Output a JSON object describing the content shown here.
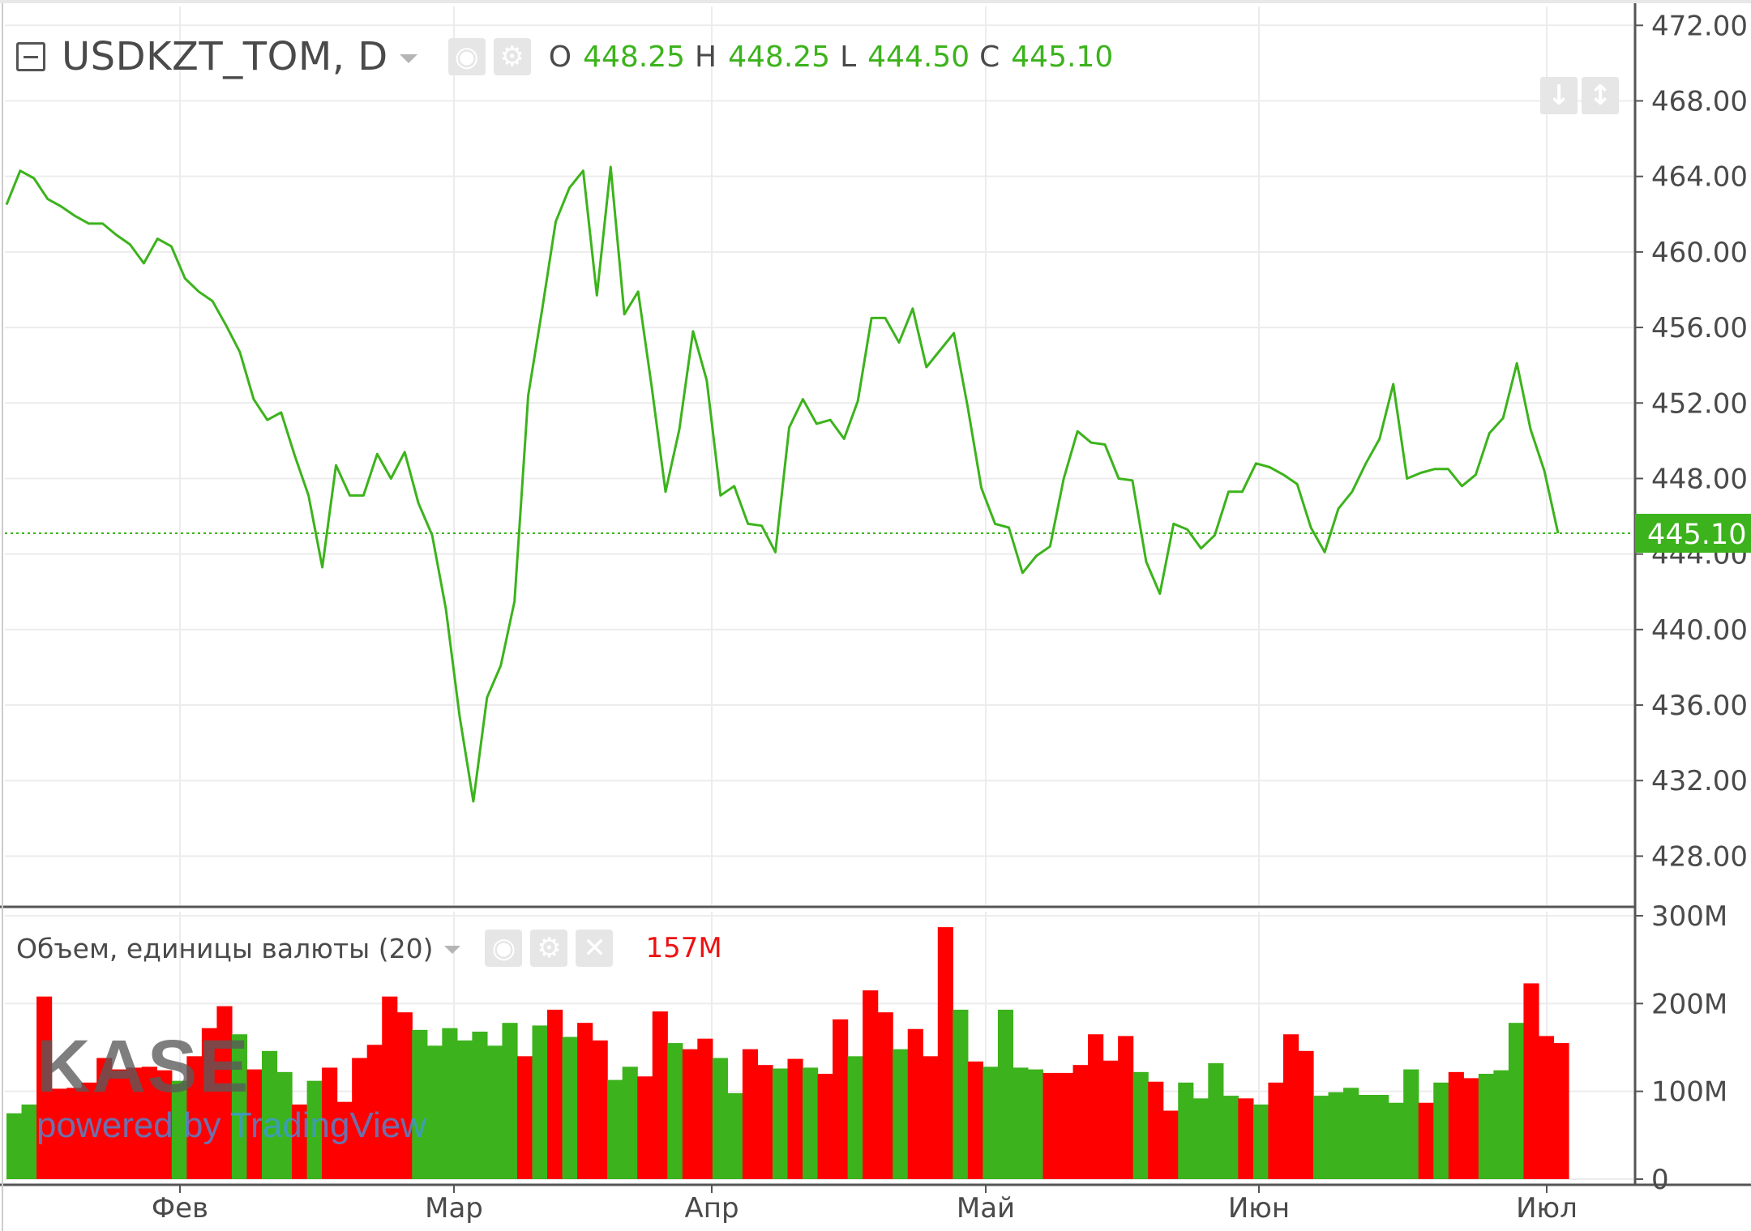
{
  "header": {
    "symbol": "USDKZT_TOM, D",
    "o_label": "O",
    "o_value": "448.25",
    "h_label": "H",
    "h_value": "448.25",
    "l_label": "L",
    "l_value": "444.50",
    "c_label": "C",
    "c_value": "445.10",
    "icons": [
      "eye-icon",
      "gear-icon"
    ]
  },
  "volume_header": {
    "title": "Объем, единицы валюты (20)",
    "value": "157M",
    "icons": [
      "eye-icon",
      "gear-icon",
      "close-icon"
    ]
  },
  "scroll_buttons": [
    "scroll-down-icon",
    "scroll-updown-icon"
  ],
  "logo": {
    "brand": "KASE",
    "sub": "powered by TradingView"
  },
  "colors": {
    "line": "#3cb31c",
    "up": "#3cb31c",
    "down": "#ff0000",
    "grid": "#ececec",
    "text": "#4a4a4a",
    "last_price_bg": "#3cb31c"
  },
  "chart_data": [
    {
      "type": "line",
      "title": "USDKZT_TOM, D",
      "series": [
        {
          "values": [
            462.5,
            464.3,
            463.9,
            462.8,
            462.4,
            461.9,
            461.5,
            461.5,
            460.9,
            460.4,
            459.4,
            460.7,
            460.3,
            458.6,
            457.9,
            457.4,
            456.1,
            454.7,
            452.2,
            451.1,
            451.5,
            449.2,
            447.1,
            443.3,
            448.7,
            447.1,
            447.1,
            449.3,
            448.0,
            449.4,
            446.7,
            445.0,
            441.1,
            435.4,
            430.9,
            436.4,
            438.1,
            441.5,
            452.4,
            456.9,
            461.6,
            463.4,
            464.3,
            457.7,
            464.5,
            456.7,
            457.9,
            452.8,
            447.3,
            450.6,
            455.8,
            453.2,
            447.1,
            447.6,
            445.6,
            445.5,
            444.1,
            450.7,
            452.2,
            450.9,
            451.1,
            450.1,
            452.1,
            456.5,
            456.5,
            455.2,
            457.0,
            453.9,
            454.8,
            455.7,
            451.8,
            447.5,
            445.6,
            445.4,
            443.0,
            443.9,
            444.4,
            448.0,
            450.5,
            449.9,
            449.8,
            448.0,
            447.9,
            443.6,
            441.9,
            445.6,
            445.3,
            444.3,
            445.0,
            447.3,
            447.3,
            448.8,
            448.6,
            448.2,
            447.7,
            445.4,
            444.1,
            446.4,
            447.3,
            448.8,
            450.1,
            453.0,
            448.0,
            448.3,
            448.5,
            448.5,
            447.6,
            448.2,
            450.4,
            451.2,
            454.1,
            450.6,
            448.4,
            445.1
          ]
        }
      ],
      "x_labels": [
        "Фев",
        "Мар",
        "Апр",
        "Май",
        "Июн",
        "Июл"
      ],
      "y_ticks": [
        "472.00",
        "468.00",
        "464.00",
        "460.00",
        "456.00",
        "452.00",
        "448.00",
        "444.00",
        "440.00",
        "436.00",
        "432.00",
        "428.00"
      ],
      "ylim": [
        425.4,
        473.0
      ],
      "last_price": 445.1,
      "last_price_label": "445.10",
      "grid": true
    },
    {
      "type": "bar",
      "title": "Объем, единицы валюты (20)",
      "values_millions": [
        75,
        85,
        208,
        103,
        104,
        110,
        138,
        125,
        127,
        128,
        124,
        112,
        140,
        172,
        197,
        165,
        125,
        146,
        122,
        85,
        112,
        127,
        88,
        138,
        153,
        208,
        190,
        170,
        152,
        172,
        158,
        168,
        152,
        178,
        140,
        175,
        193,
        162,
        178,
        158,
        113,
        128,
        117,
        191,
        155,
        148,
        160,
        138,
        98,
        148,
        130,
        126,
        137,
        127,
        120,
        182,
        140,
        215,
        190,
        148,
        171,
        140,
        287,
        193,
        134,
        128,
        193,
        127,
        125,
        121,
        121,
        130,
        165,
        135,
        163,
        122,
        111,
        78,
        110,
        92,
        132,
        95,
        92,
        85,
        110,
        165,
        146,
        95,
        99,
        104,
        96,
        96,
        87,
        125,
        87,
        110,
        122,
        115,
        120,
        124,
        178,
        223,
        163,
        155
      ],
      "up_flags": [
        1,
        1,
        0,
        0,
        0,
        0,
        0,
        0,
        0,
        0,
        0,
        1,
        0,
        0,
        0,
        1,
        0,
        1,
        1,
        0,
        1,
        0,
        0,
        0,
        0,
        0,
        0,
        1,
        1,
        1,
        1,
        1,
        1,
        1,
        0,
        1,
        0,
        1,
        0,
        0,
        1,
        1,
        0,
        0,
        1,
        0,
        0,
        1,
        1,
        0,
        0,
        1,
        0,
        1,
        0,
        0,
        1,
        0,
        0,
        1,
        0,
        0,
        0,
        1,
        0,
        1,
        1,
        1,
        1,
        0,
        0,
        0,
        0,
        0,
        0,
        1,
        0,
        0,
        1,
        1,
        1,
        1,
        0,
        1,
        0,
        0,
        0,
        1,
        1,
        1,
        1,
        1,
        1,
        1,
        0,
        1,
        0,
        0,
        1,
        1,
        1,
        0,
        0,
        0
      ],
      "y_ticks": [
        "300M",
        "200M",
        "100M",
        "0"
      ],
      "ylim": [
        0,
        300
      ],
      "last_value_label": "157M"
    }
  ]
}
